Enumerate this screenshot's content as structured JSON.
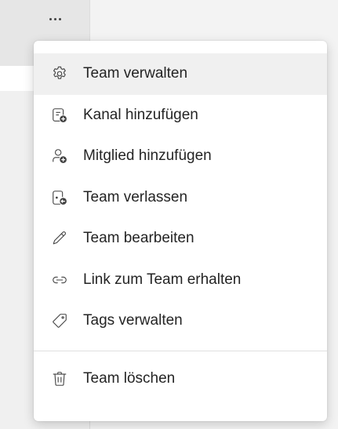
{
  "topbar": {
    "more_icon": "more-horizontal-icon"
  },
  "menu": {
    "items": [
      {
        "label": "Team verwalten",
        "icon": "gear-icon"
      },
      {
        "label": "Kanal hinzufügen",
        "icon": "channel-add-icon"
      },
      {
        "label": "Mitglied hinzufügen",
        "icon": "person-add-icon"
      },
      {
        "label": "Team verlassen",
        "icon": "leave-team-icon"
      },
      {
        "label": "Team bearbeiten",
        "icon": "pencil-icon"
      },
      {
        "label": "Link zum Team erhalten",
        "icon": "link-icon"
      },
      {
        "label": "Tags verwalten",
        "icon": "tag-icon"
      }
    ],
    "danger_items": [
      {
        "label": "Team löschen",
        "icon": "trash-icon"
      }
    ]
  },
  "colors": {
    "text": "#242424",
    "icon": "#424242",
    "hover": "#f0f0f0"
  }
}
